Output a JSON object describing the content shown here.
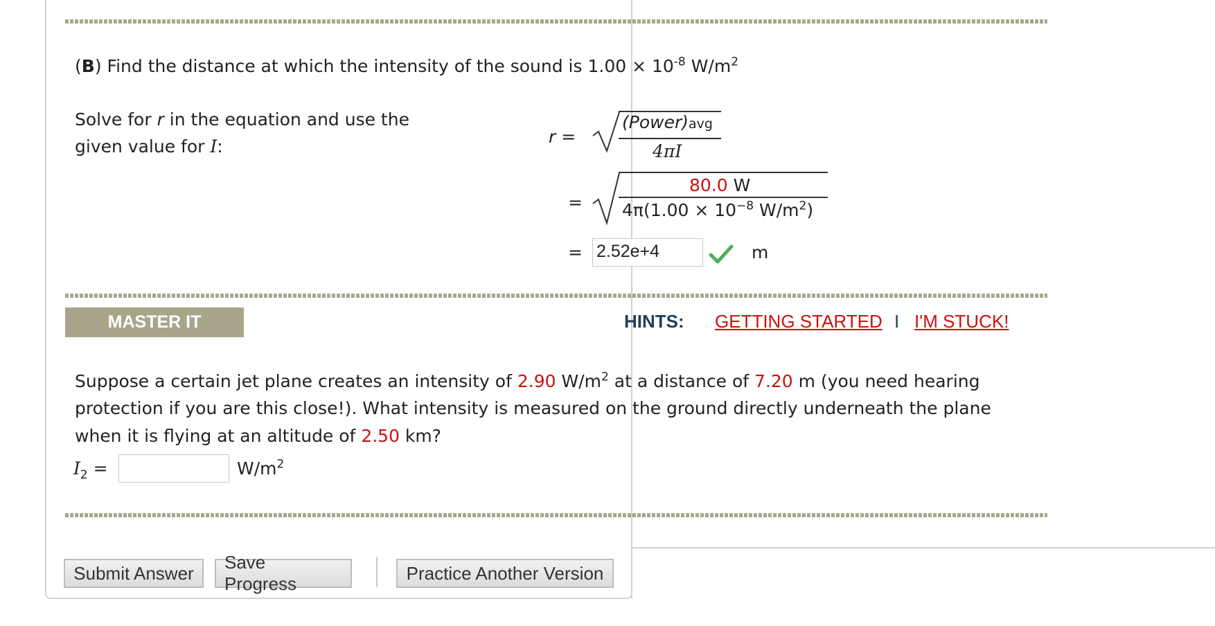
{
  "part_b": {
    "label": "B",
    "question_pre": "Find the distance at which the intensity of the sound is 1.00 × 10",
    "question_exp": "-8",
    "question_unit_pre": "W/m",
    "question_unit_exp": "2",
    "solve_line1_pre": "Solve for ",
    "solve_var_r": "r",
    "solve_line1_post": " in the equation and use the",
    "solve_line2_pre": "given value for ",
    "solve_var_i": "I",
    "solve_line2_post": ":",
    "eq_r": "r",
    "eq_equals": "=",
    "power_label": "(Power)",
    "power_sub": "avg",
    "denominator_symbolic": "4πI",
    "numerator_value": "80.0",
    "numerator_unit": "W",
    "denominator_value_pre": "4π(1.00 × 10",
    "denominator_value_exp": "−8",
    "denominator_value_unit": " W/m",
    "denominator_value_unit_exp": "2",
    "denominator_value_close": ")",
    "answer_value": "2.52e+4",
    "answer_unit": "m"
  },
  "master_it": {
    "tab_label": "MASTER IT",
    "hints_label": "HINTS:",
    "hint_getting_started": "GETTING STARTED",
    "hint_separator": "I",
    "hint_stuck": "I'M STUCK!",
    "problem_seg1": "Suppose a certain jet plane creates an intensity of ",
    "intensity_value": "2.90",
    "problem_seg2": " W/m",
    "problem_seg2_exp": "2",
    "problem_seg3": " at a distance of ",
    "distance_value": "7.20",
    "problem_seg4": " m (you need hearing",
    "problem_line2": "protection if you are this close!). What intensity is measured on the ground directly underneath the plane",
    "problem_line3_pre": "when it is flying at an altitude of ",
    "altitude_value": "2.50",
    "problem_line3_post": " km?",
    "answer_var": "I",
    "answer_var_sub": "2",
    "answer_equals": "=",
    "answer_value": "",
    "answer_unit": "W/m",
    "answer_unit_exp": "2"
  },
  "buttons": {
    "submit": "Submit Answer",
    "save": "Save Progress",
    "practice": "Practice Another Version"
  },
  "colors": {
    "accent_red": "#cc1111",
    "tab_bg": "#a8a58a",
    "divider": "#a8a88a",
    "check_green": "#4caf50"
  }
}
